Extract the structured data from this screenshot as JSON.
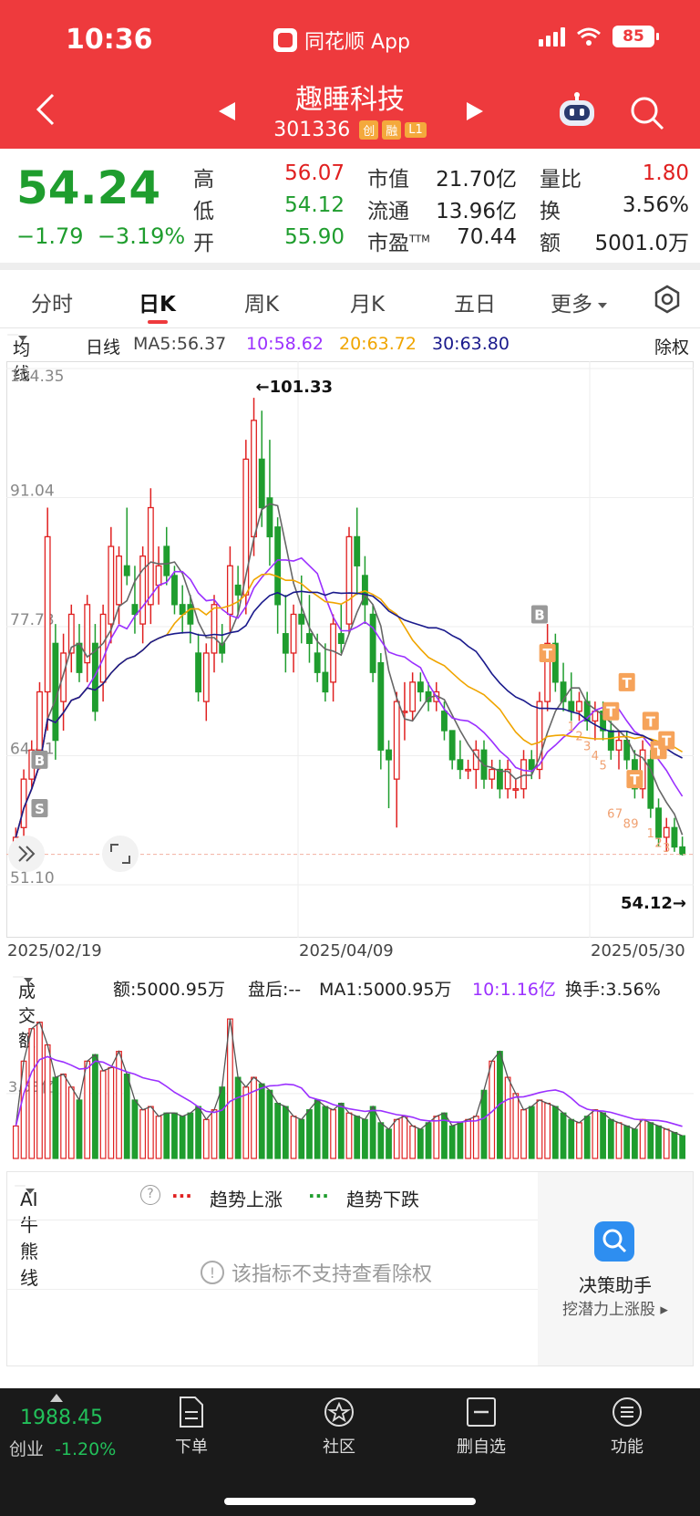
{
  "status_bar": {
    "time": "10:36",
    "app_name": "同花顺 App",
    "battery": "85"
  },
  "nav": {
    "stock_name": "趣睡科技",
    "stock_code": "301336",
    "tags": [
      "创",
      "融",
      "L1"
    ]
  },
  "quote": {
    "price": "54.24",
    "change": "−1.79",
    "change_pct": "−3.19%",
    "fields": [
      {
        "label": "高",
        "value": "56.07"
      },
      {
        "label": "低",
        "value": "54.12"
      },
      {
        "label": "开",
        "value": "55.90"
      },
      {
        "label": "市值",
        "value": "21.70亿"
      },
      {
        "label": "流通",
        "value": "13.96亿"
      },
      {
        "label": "市盈",
        "sup": "TTM",
        "value": "70.44"
      },
      {
        "label": "量比",
        "value": "1.80"
      },
      {
        "label": "换",
        "value": "3.56%"
      },
      {
        "label": "额",
        "value": "5001.0万"
      }
    ]
  },
  "tabs": [
    "分时",
    "日K",
    "周K",
    "月K",
    "五日",
    "更多"
  ],
  "ma_bar": {
    "selector": "均线",
    "period": "日线",
    "ma5": "MA5:56.37",
    "ma10": "10:58.62",
    "ma20": "20:63.72",
    "ma30": "30:63.80",
    "adjust": "除权"
  },
  "colors": {
    "up": "#e02020",
    "down": "#1f9d2e",
    "ma5": "#666666",
    "ma10": "#9b30ff",
    "ma20": "#f0a500",
    "ma30": "#1a1a8c",
    "header": "#ee3a3d"
  },
  "chart_data": [
    {
      "type": "candlestick",
      "y_ticks": [
        "104.35",
        "91.04",
        "77.73",
        "64.41",
        "51.10"
      ],
      "ylim": [
        51.1,
        104.35
      ],
      "x_ticks": [
        "2025/02/19",
        "2025/04/09",
        "2025/05/30"
      ],
      "annotations": {
        "high": "←101.33",
        "low": "54.12→"
      },
      "signal_labels": [
        "B",
        "S",
        "T",
        "1",
        "2",
        "3",
        "4",
        "5",
        "6",
        "7",
        "8",
        "9"
      ],
      "candles": [
        [
          55,
          57,
          53,
          56
        ],
        [
          57,
          63,
          55,
          62
        ],
        [
          62,
          66,
          61,
          65
        ],
        [
          65,
          72,
          63,
          71
        ],
        [
          71,
          90,
          67,
          87
        ],
        [
          76,
          78,
          64,
          66
        ],
        [
          70,
          77,
          67,
          75
        ],
        [
          75,
          80,
          73,
          79
        ],
        [
          76,
          78,
          72,
          73
        ],
        [
          74,
          81,
          72,
          80
        ],
        [
          76,
          78,
          68,
          69
        ],
        [
          72,
          80,
          70,
          79
        ],
        [
          78,
          88,
          76,
          86
        ],
        [
          80,
          86,
          78,
          85
        ],
        [
          84,
          90,
          82,
          83
        ],
        [
          80,
          84,
          77,
          79
        ],
        [
          78,
          86,
          76,
          85
        ],
        [
          80,
          92,
          78,
          90
        ],
        [
          82,
          86,
          80,
          84
        ],
        [
          86,
          88,
          82,
          83
        ],
        [
          83,
          84,
          79,
          80
        ],
        [
          80,
          82,
          77,
          79
        ],
        [
          80,
          81,
          76,
          78
        ],
        [
          75,
          77,
          70,
          71
        ],
        [
          70,
          76,
          68,
          75
        ],
        [
          75,
          81,
          73,
          80
        ],
        [
          76,
          78,
          74,
          75
        ],
        [
          79,
          86,
          77,
          84
        ],
        [
          82,
          84,
          79,
          81
        ],
        [
          81,
          97,
          79,
          95
        ],
        [
          87,
          101.33,
          85,
          99
        ],
        [
          95,
          100,
          88,
          90
        ],
        [
          91,
          97,
          84,
          87
        ],
        [
          88,
          89,
          77,
          80
        ],
        [
          77,
          81,
          73,
          75
        ],
        [
          75,
          80,
          73,
          79
        ],
        [
          79,
          83,
          76,
          78
        ],
        [
          77,
          81,
          74,
          76
        ],
        [
          75,
          77,
          72,
          73
        ],
        [
          73,
          76,
          70,
          71
        ],
        [
          72,
          79,
          70,
          78
        ],
        [
          77,
          80,
          75,
          76
        ],
        [
          78,
          88,
          77,
          87
        ],
        [
          87,
          90,
          81,
          84
        ],
        [
          83,
          85,
          78,
          80
        ],
        [
          79,
          80,
          72,
          73
        ],
        [
          74,
          75,
          63,
          65
        ],
        [
          65,
          66,
          59,
          64
        ],
        [
          62,
          71,
          57,
          70
        ],
        [
          69,
          72,
          66,
          69
        ],
        [
          69,
          73,
          68,
          72
        ],
        [
          72,
          73,
          70,
          71
        ],
        [
          71,
          72,
          69,
          70
        ],
        [
          70,
          72,
          69,
          71
        ],
        [
          69,
          70,
          66,
          67
        ],
        [
          67,
          67,
          63,
          64
        ],
        [
          64,
          66,
          62,
          63
        ],
        [
          63,
          64,
          62,
          63
        ],
        [
          63,
          66,
          61,
          65
        ],
        [
          65,
          66,
          61,
          62
        ],
        [
          62,
          64,
          61,
          63
        ],
        [
          63,
          64,
          60,
          61
        ],
        [
          61,
          64,
          60,
          63
        ],
        [
          61,
          62,
          60,
          61
        ],
        [
          61,
          65,
          60,
          64
        ],
        [
          64,
          65,
          62,
          63
        ],
        [
          63,
          71,
          62,
          70
        ],
        [
          70,
          78,
          69,
          76
        ],
        [
          76,
          77,
          71,
          72
        ],
        [
          72,
          74,
          69,
          70
        ],
        [
          70,
          73,
          68,
          69
        ],
        [
          69,
          71,
          68,
          70
        ],
        [
          70,
          71,
          67,
          68
        ],
        [
          68,
          70,
          66,
          69
        ],
        [
          69,
          70,
          66,
          67
        ],
        [
          67,
          68,
          64,
          65
        ],
        [
          65,
          67,
          63,
          66
        ],
        [
          66,
          67,
          63,
          64
        ],
        [
          64,
          65,
          60,
          61
        ],
        [
          61,
          66,
          60,
          65
        ],
        [
          64,
          65,
          58,
          59
        ],
        [
          59,
          60,
          55,
          56
        ],
        [
          56,
          58,
          54.5,
          57
        ],
        [
          57,
          58,
          54.5,
          55
        ],
        [
          55,
          56.07,
          54.12,
          54.24
        ]
      ]
    },
    {
      "type": "bar",
      "title": "成交额",
      "y_ticks": [
        "3.53亿"
      ],
      "values": [
        1,
        3,
        4,
        4.2,
        3.5,
        2.5,
        2.6,
        2.2,
        1.8,
        3,
        3.2,
        2.7,
        2.8,
        3.3,
        2.6,
        1.8,
        1.5,
        1.6,
        1.3,
        1.4,
        1.4,
        1.3,
        1.4,
        1.6,
        1.2,
        1.5,
        2.2,
        4.3,
        2.5,
        2.2,
        2.5,
        2.3,
        2.1,
        1.7,
        1.6,
        1.3,
        1.2,
        1.5,
        1.8,
        1.6,
        1.5,
        1.7,
        1.4,
        1.3,
        1.2,
        1.6,
        1.1,
        0.9,
        1.2,
        1.3,
        1.0,
        0.9,
        1.1,
        1.3,
        1.4,
        1.0,
        1.1,
        1.2,
        1.3,
        2.1,
        3.0,
        3.3,
        2.5,
        2.0,
        1.5,
        1.6,
        1.8,
        1.7,
        1.6,
        1.4,
        1.2,
        1.1,
        1.3,
        1.5,
        1.4,
        1.2,
        1.1,
        1.0,
        0.9,
        1.2,
        1.1,
        1.0,
        0.9,
        0.8,
        0.7
      ]
    }
  ],
  "volume_bar": {
    "selector": "成交额",
    "amount": "额:5000.95万",
    "after_hours": "盘后:--",
    "ma1": "MA1:5000.95万",
    "ma10": "10:1.16亿",
    "turnover": "换手:3.56%"
  },
  "ai_panel": {
    "selector": "AI牛熊线",
    "legend_up": "趋势上涨",
    "legend_down": "趋势下跌",
    "notice": "该指标不支持查看除权",
    "assist_title": "决策助手",
    "assist_sub": "挖潜力上涨股"
  },
  "bottom_nav": {
    "index_value": "1988.45",
    "index_name": "创业",
    "index_change": "-1.20%",
    "items": [
      "下单",
      "社区",
      "删自选",
      "功能"
    ]
  }
}
